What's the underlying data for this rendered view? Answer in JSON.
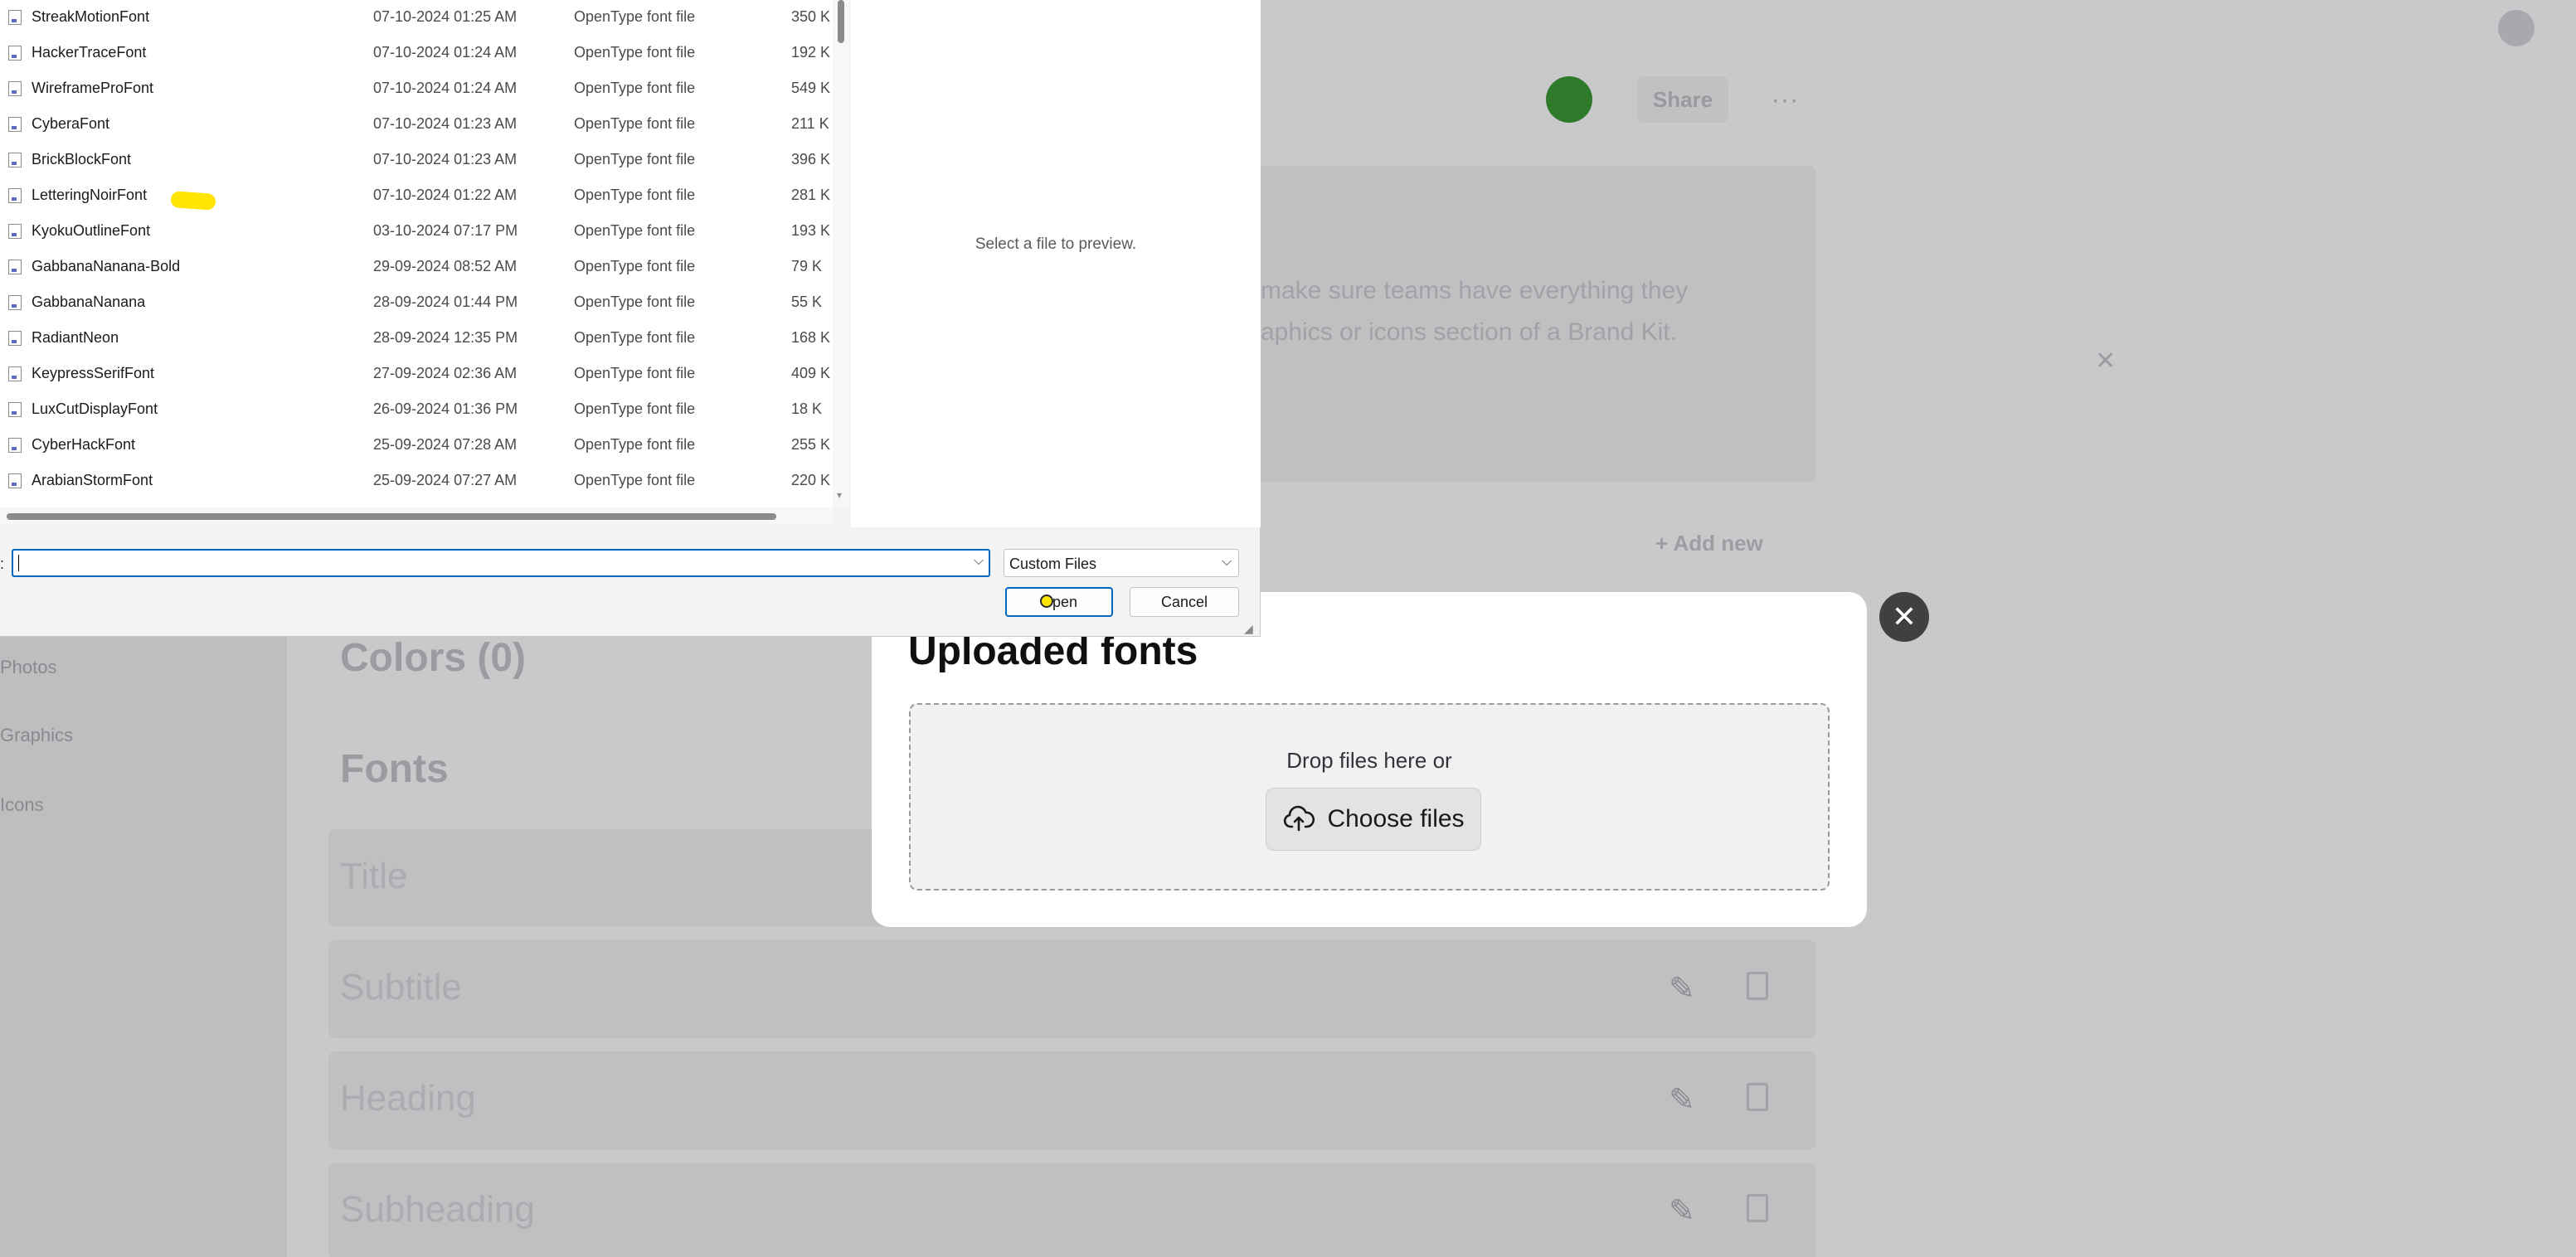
{
  "file_dialog": {
    "files": [
      {
        "name": "StreakMotionFont",
        "date": "07-10-2024 01:25 AM",
        "type": "OpenType font file",
        "size": "350 K"
      },
      {
        "name": "HackerTraceFont",
        "date": "07-10-2024 01:24 AM",
        "type": "OpenType font file",
        "size": "192 K"
      },
      {
        "name": "WireframeProFont",
        "date": "07-10-2024 01:24 AM",
        "type": "OpenType font file",
        "size": "549 K"
      },
      {
        "name": "CyberaFont",
        "date": "07-10-2024 01:23 AM",
        "type": "OpenType font file",
        "size": "211 K"
      },
      {
        "name": "BrickBlockFont",
        "date": "07-10-2024 01:23 AM",
        "type": "OpenType font file",
        "size": "396 K"
      },
      {
        "name": "LetteringNoirFont",
        "date": "07-10-2024 01:22 AM",
        "type": "OpenType font file",
        "size": "281 K"
      },
      {
        "name": "KyokuOutlineFont",
        "date": "03-10-2024 07:17 PM",
        "type": "OpenType font file",
        "size": "193 K"
      },
      {
        "name": "GabbanaNanana-Bold",
        "date": "29-09-2024 08:52 AM",
        "type": "OpenType font file",
        "size": "79 K"
      },
      {
        "name": "GabbanaNanana",
        "date": "28-09-2024 01:44 PM",
        "type": "OpenType font file",
        "size": "55 K"
      },
      {
        "name": "RadiantNeon",
        "date": "28-09-2024 12:35 PM",
        "type": "OpenType font file",
        "size": "168 K"
      },
      {
        "name": "KeypressSerifFont",
        "date": "27-09-2024 02:36 AM",
        "type": "OpenType font file",
        "size": "409 K"
      },
      {
        "name": "LuxCutDisplayFont",
        "date": "26-09-2024 01:36 PM",
        "type": "OpenType font file",
        "size": "18 K"
      },
      {
        "name": "CyberHackFont",
        "date": "25-09-2024 07:28 AM",
        "type": "OpenType font file",
        "size": "255 K"
      },
      {
        "name": "ArabianStormFont",
        "date": "25-09-2024 07:27 AM",
        "type": "OpenType font file",
        "size": "220 K"
      }
    ],
    "preview_text": "Select a file to preview.",
    "filename_label": ":",
    "filename_value": "",
    "filetype_value": "Custom Files",
    "open_label": "Open",
    "cancel_label": "Cancel"
  },
  "upload_modal": {
    "title": "Uploaded fonts",
    "drop_text": "Drop files here or",
    "choose_label": "Choose files",
    "close_glyph": "✕"
  },
  "background": {
    "share_label": "Share",
    "more_glyph": "···",
    "banner_lines": [
      "make sure teams have everything they",
      "aphics or icons section of a Brand Kit."
    ],
    "add_new_label": "+ Add new",
    "sidebar_items": [
      "Photos",
      "Graphics",
      "Icons"
    ],
    "colors_title": "Colors (0)",
    "fonts_title": "Fonts",
    "font_rows": [
      "Title",
      "Subtitle",
      "Heading",
      "Subheading"
    ]
  },
  "colors": {
    "accent": "#0067c0",
    "highlight": "#ffe500",
    "avatar_green": "#2f7a2a"
  }
}
